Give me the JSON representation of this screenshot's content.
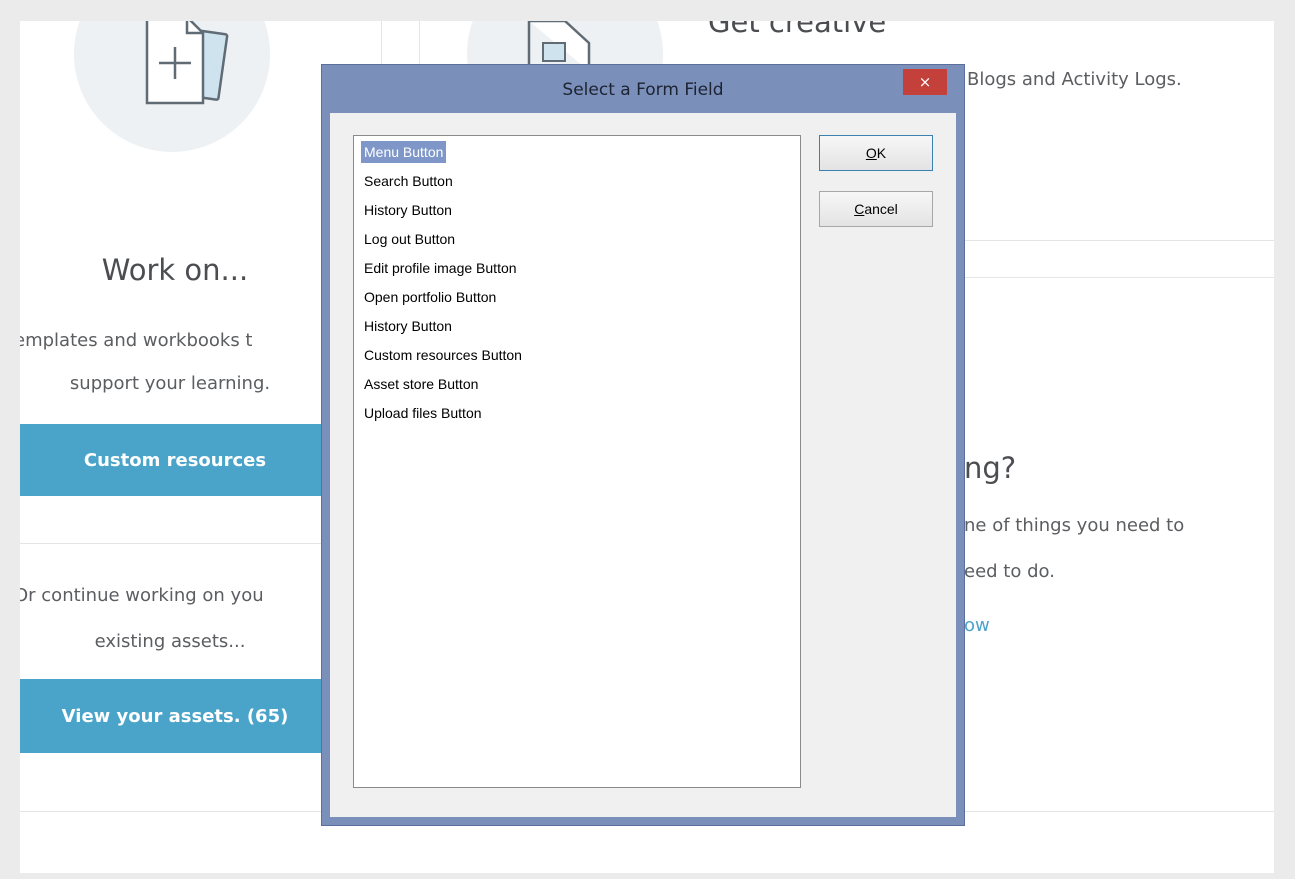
{
  "background": {
    "left_heading": "Work on...",
    "left_body_line1": "emplates and workbooks t",
    "left_body_line2": "support your learning.",
    "custom_resources_button": "Custom resources",
    "continue_line1": "Or continue working on you",
    "continue_line2": "existing assets...",
    "view_assets_button": "View your assets. (65)",
    "right_top_heading": "Get creative",
    "right_top_body": "Blogs and Activity Logs.",
    "right_heading_partial": "ng?",
    "right_body_line1": "ne of things you need to",
    "right_body_line2": "eed to do.",
    "right_link_partial": "ow"
  },
  "dialog": {
    "title": "Select a Form Field",
    "close_glyph": "×",
    "ok_label": "OK",
    "cancel_label": "Cancel",
    "items": [
      "Menu Button",
      "Search Button",
      "History Button",
      "Log out Button",
      "Edit profile image Button",
      "Open portfolio Button",
      "History Button",
      "Custom resources Button",
      "Asset store Button",
      "Upload files Button"
    ],
    "selected_index": 0
  },
  "colors": {
    "accent_blue": "#4aa3c8",
    "dialog_frame": "#7b8fbb",
    "close_red": "#c4403a",
    "selection": "#7e97c8"
  }
}
